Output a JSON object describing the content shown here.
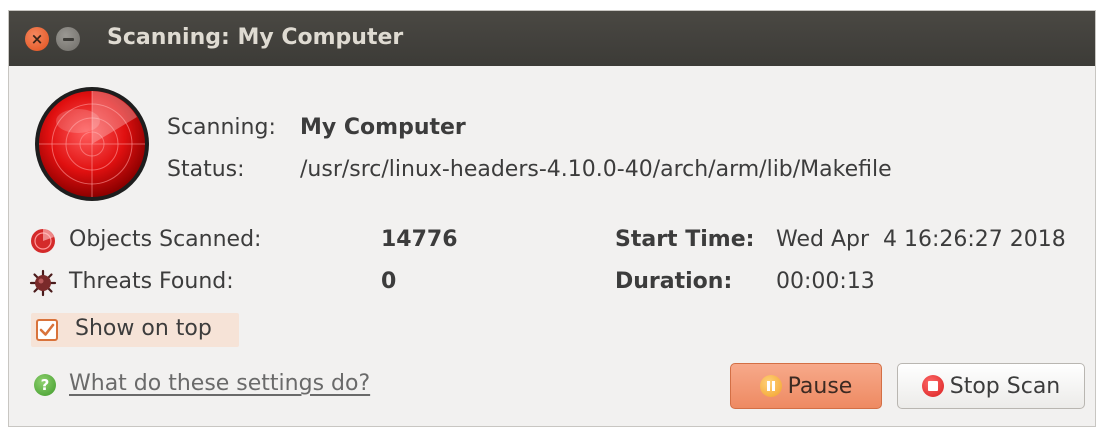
{
  "window": {
    "title": "Scanning: My Computer",
    "close_glyph": "×"
  },
  "scan": {
    "scanning_label": "Scanning:",
    "scanning_value": "My Computer",
    "status_label": "Status:",
    "status_value": "/usr/src/linux-headers-4.10.0-40/arch/arm/lib/Makefile"
  },
  "stats": {
    "objects_label": "Objects Scanned:",
    "objects_value": "14776",
    "threats_label": "Threats Found:",
    "threats_value": "0",
    "start_time_label": "Start Time:",
    "start_time_value": "Wed Apr  4 16:26:27 2018",
    "duration_label": "Duration:",
    "duration_value": "00:00:13"
  },
  "options": {
    "show_on_top_label": "Show on top",
    "show_on_top_checked": true
  },
  "help": {
    "link_text": "What do these settings do?",
    "icon_glyph": "?"
  },
  "buttons": {
    "pause_label": "Pause",
    "stop_label": "Stop Scan"
  },
  "icons": {
    "radar": "radar-icon",
    "objects": "scan-disc-icon",
    "threats": "virus-icon",
    "help": "help-icon",
    "pause": "pause-icon",
    "stop": "stop-icon"
  },
  "colors": {
    "accent": "#ee8a62",
    "radar": "#e01010",
    "titlebar": "#3c3b37",
    "checkbox_border": "#d9733b"
  }
}
